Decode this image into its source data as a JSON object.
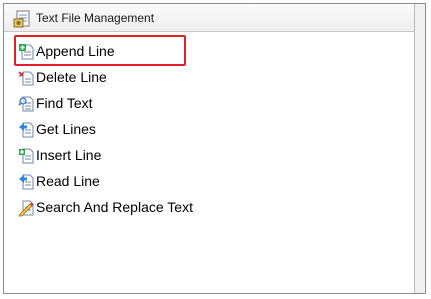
{
  "panel": {
    "title": "Text File Management",
    "title_icon": "text-file-management-icon"
  },
  "highlight_color": "#e0202a",
  "items": [
    {
      "label": "Append Line",
      "icon": "append-line-icon",
      "highlighted": true
    },
    {
      "label": "Delete Line",
      "icon": "delete-line-icon"
    },
    {
      "label": "Find Text",
      "icon": "find-text-icon"
    },
    {
      "label": "Get Lines",
      "icon": "get-lines-icon"
    },
    {
      "label": "Insert Line",
      "icon": "insert-line-icon"
    },
    {
      "label": "Read Line",
      "icon": "read-line-icon"
    },
    {
      "label": "Search And Replace Text",
      "icon": "search-and-replace-text-icon"
    }
  ]
}
